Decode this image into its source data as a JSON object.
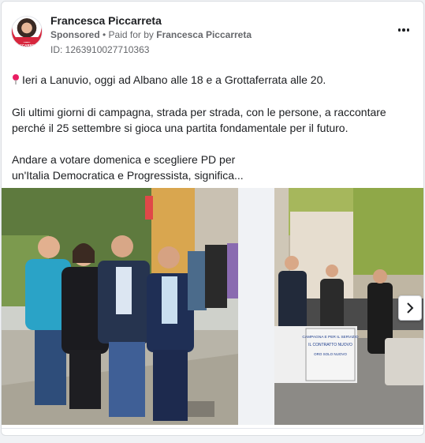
{
  "post": {
    "author": "Francesca Piccarreta",
    "sponsored": "Sponsored",
    "paid_prefix": " • Paid for by ",
    "payer": "Francesca Piccarreta",
    "ad_id": "ID: 1263910027710363",
    "avatar_text": "PICCARRETA",
    "paragraphs": [
      "Ieri a Lanuvio, oggi ad Albano alle 18 e a Grottaferrata alle 20.",
      "Gli ultimi giorni di campagna, strada per strada, con le persone, a raccontare perché il 25 settembre si gioca una partita fondamentale per il futuro.",
      "Andare a votare domenica e scegliere PD per\nun'Italia Democratica e Progressista, significa..."
    ]
  },
  "carousel": {
    "banner_line1": "CAMPAGNA E PER IL SERVIZIO",
    "banner_line2": "IL CONTRATTO NUOVO",
    "banner_line3": "ORO SOLO NUOVO"
  },
  "icons": {
    "pin": "pin-icon",
    "more": "more-options-icon",
    "next": "chevron-right-icon"
  },
  "colors": {
    "pin": "#e91e63",
    "brand_red": "#d7263d",
    "text_secondary": "#65676b"
  }
}
